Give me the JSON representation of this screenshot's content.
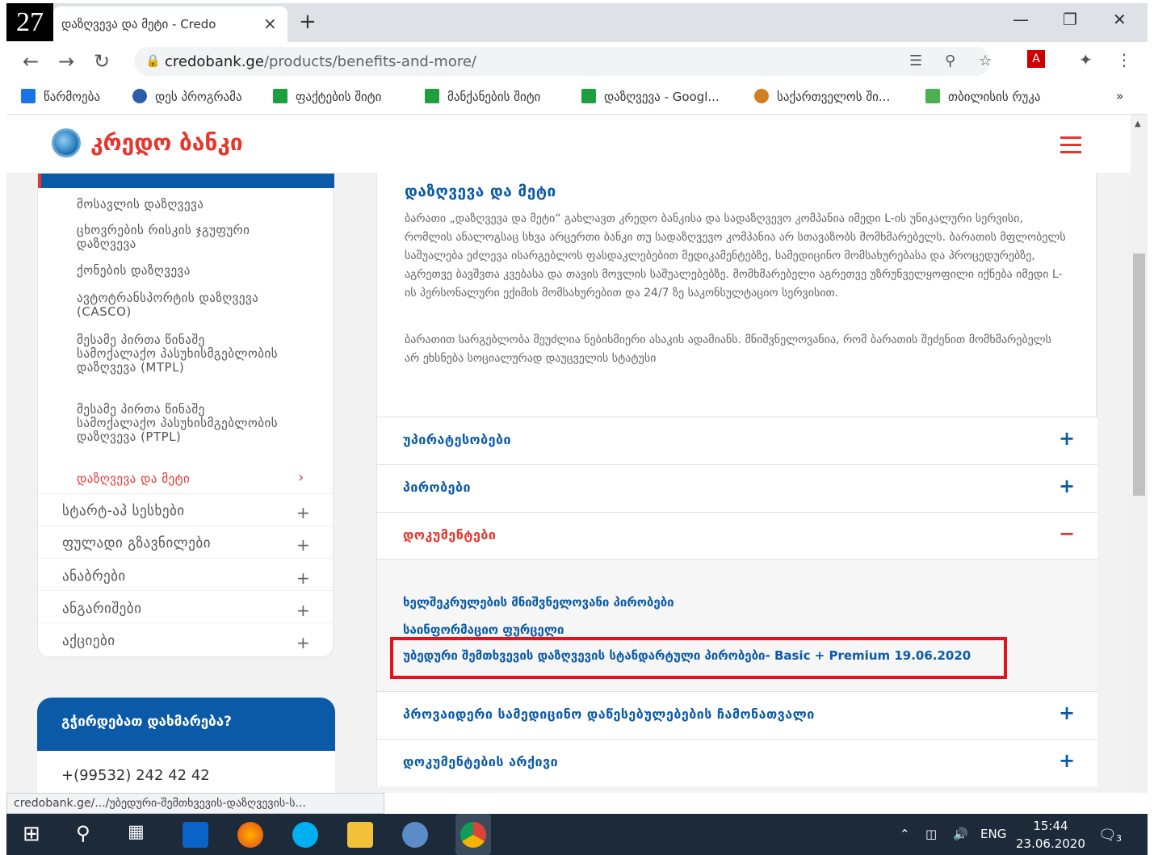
{
  "badge": "27",
  "browser": {
    "tab_title": "დაზღვევა და მეტი - Credo",
    "tab_close": "×",
    "new_tab": "+",
    "url_domain": "credobank.ge",
    "url_path": "/products/benefits-and-more/",
    "bookmarks": [
      {
        "label": "წარმოება",
        "color": "#1a73e8"
      },
      {
        "label": "დეს პროგრამა",
        "color": "#2a5ea8"
      },
      {
        "label": "ფაქტების შიტი",
        "color": "#1e9e3e"
      },
      {
        "label": "მანქანების შიტი",
        "color": "#1e9e3e"
      },
      {
        "label": "დაზღვევა - Googl...",
        "color": "#1e9e3e"
      },
      {
        "label": "საქართველოს ში...",
        "color": "#d08020"
      },
      {
        "label": "თბილისის რუკა",
        "color": "#4caf50"
      }
    ],
    "bookmarks_more": "»"
  },
  "site": {
    "logo_text": "კრედო ბანკი"
  },
  "sidebar": {
    "sub_items": [
      "მოსავლის დაზღვევა",
      "ცხოვრების რისკის ჯგუფური დაზღვევა",
      "ქონების დაზღვევა",
      "ავტოტრანსპორტის დაზღვევა (CASCO)",
      "მესამე პირთა წინაშე სამოქალაქო პასუხისმგებლობის დაზღვევა (MTPL)",
      "მესამე პირთა წინაშე სამოქალაქო პასუხისმგებლობის დაზღვევა (PTPL)",
      "დაზღვევა და მეტი"
    ],
    "active_chevron": "›",
    "categories": [
      "სტარტ-აპ სესხები",
      "ფულადი გზავნილები",
      "ანაბრები",
      "ანგარიშები",
      "აქციები"
    ],
    "plus": "+"
  },
  "help": {
    "question": "გჭირდებათ დახმარება?",
    "phone": "+(99532) 242 42 42"
  },
  "main": {
    "title": "დაზღვევა და მეტი",
    "paragraphs": [
      "ბარათი „დაზღვევა და მეტი“ გახლავთ კრედო ბანკისა და სადაზღვევო კომპანია იმედი L-ის უნიკალური სერვისი, რომლის ანალოგსაც სხვა არცერთი ბანკი თუ სადაზღვევო კომპანია არ სთავაზობს მომხმარებელს. ბარათის მფლობელს საშუალება ეძლევა ისარგებლოს ფასდაკლებებით მედიკამენტებზე, სამედიცინო მომსახურებასა და პროცედურებზე, აგრეთვე ბავშვთა კვებასა და თავის მოვლის საშუალებებზე. მომხმარებელი აგრეთვე უზრუნველყოფილი იქნება იმედი L-ის პერსონალური ექიმის მომსახურებით და 24/7 ზე საკონსულტაციო სერვისით.",
      "ბარათით სარგებლობა შეუძლია ნებისმიერი ასაკის ადამიანს. მნიშვნელოვანია, რომ ბარათის შეძენით მომხმარებელს არ ეხსნება სოციალურად დაუცველის სტატუსი"
    ],
    "accordions": [
      {
        "label": "უპირატესობები",
        "sign": "+"
      },
      {
        "label": "პირობები",
        "sign": "+"
      },
      {
        "label": "დოკუმენტები",
        "sign": "−"
      },
      {
        "label": "პროვაიდერი სამედიცინო დაწესებულებების ჩამონათვალი",
        "sign": "+"
      },
      {
        "label": "დოკუმენტების არქივი",
        "sign": "+"
      }
    ],
    "doc_links": [
      "ხელშეკრულების მნიშვნელოვანი პირობები",
      "საინფორმაციო ფურცელი",
      "უბედური შემთხვევის დაზღვევის სტანდარტული პირობები- Basic + Premium 19.06.2020"
    ]
  },
  "status_url": "credobank.ge/.../უბედური-შემთხვევის-დაზღვევის-ს...",
  "taskbar": {
    "lang": "ENG",
    "time": "15:44",
    "date": "23.06.2020",
    "notification_count": "3"
  }
}
